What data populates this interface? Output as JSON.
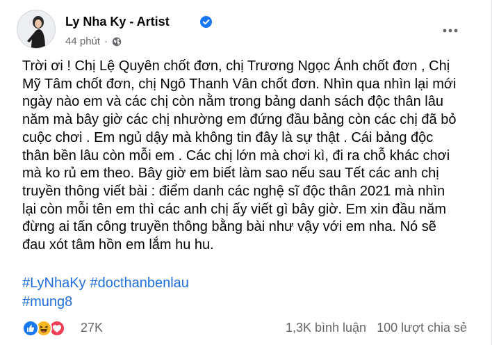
{
  "post": {
    "author": "Ly Nha Ky - Artist",
    "time": "44 phút",
    "separator": "·",
    "privacy_icon": "globe-icon",
    "verified_icon": "verified-badge-icon",
    "more_icon": "more-horizontal-icon",
    "body": "Trời ơi ! Chị Lệ Quyên chốt đơn, chị Trương Ngọc Ánh chốt đơn , Chị\nMỹ Tâm chốt đơn, chị Ngô Thanh Vân chốt đơn. Nhìn qua nhìn lại mới\nngày nào em và các chị còn nằm trong bảng danh sách độc thân lâu\nnăm mà bây giờ các chị nhường em đứng đầu bảng còn các chị đã bỏ\ncuộc chơi . Em ngủ dậy mà không tin đây là sự thật . Cái bảng độc\nthân bền lâu còn mỗi em . Các chị lớn mà chơi kì, đi ra chỗ khác chơi\nmà ko rủ em theo. Bây giờ em biết làm sao nếu sau Tết các anh chị\ntruyền thông viết bài : điểm danh các nghệ sĩ độc thân 2021 mà nhìn\nlại còn mỗi tên em thì các anh chị ấy viết gì bây giờ. Em xin đầu năm\nđừng ai tấn công truyền thông bằng bài như vậy với em nha. Nó sẽ\nđau xót tâm hồn em lắm hu hu.",
    "hashtags": {
      "line1": [
        "#LyNhaKy",
        "#docthanbenlau"
      ],
      "line2": [
        "#mung8"
      ]
    }
  },
  "footer": {
    "reactions": [
      "like-icon",
      "haha-icon",
      "love-icon"
    ],
    "reaction_count": "27K",
    "comments": "1,3K bình luận",
    "shares": "100 lượt chia sẻ"
  },
  "colors": {
    "link": "#216fdb",
    "like": "#1877f2",
    "haha": "#f7b928",
    "love": "#f33e58",
    "secondary_text": "#65676b"
  }
}
